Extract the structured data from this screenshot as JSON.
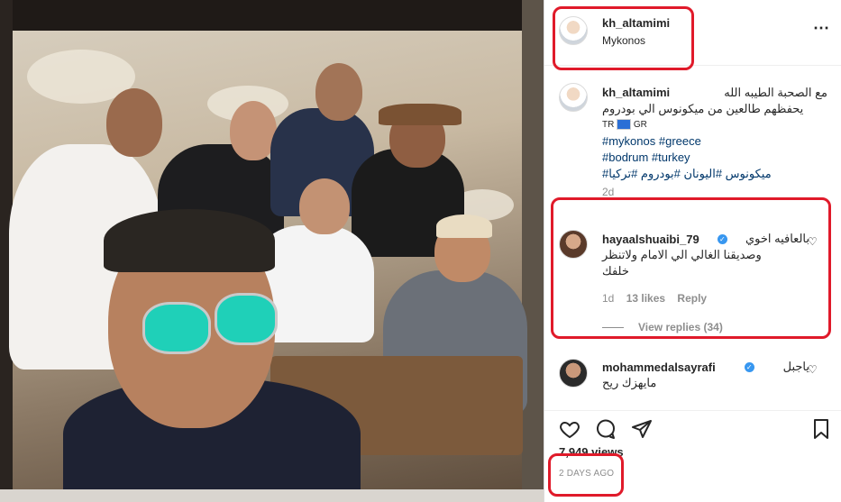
{
  "post": {
    "author": "kh_altamimi",
    "location": "Mykonos",
    "more_icon": "more-icon",
    "caption_line1": "مع الصحبة الطيبه الله",
    "caption_line2": "يحفظهم طالعين من ميكونوس الي بودروم",
    "caption_flags_left": "TR",
    "caption_flags_right": "GR",
    "hashtags_line1": "#mykonos #greece",
    "hashtags_line2": "#bodrum #turkey",
    "hashtags_line3": "ميكونوس #اليونان #بودروم #تركيا#",
    "caption_age": "2d",
    "views": "7,949 views",
    "date": "2 DAYS AGO"
  },
  "comments": [
    {
      "username": "hayaalshuaibi_79",
      "verified": true,
      "text_line1": "بالعافيه اخوي",
      "text_line2": "وصديقنا الغالي الي الامام ولاتنظر",
      "text_line3": "خلفك",
      "age": "1d",
      "likes": "13 likes",
      "reply": "Reply",
      "view_replies": "View replies (34)"
    },
    {
      "username": "mohammedalsayrafi",
      "verified": true,
      "text_line1": "ياجبل",
      "text_line2": "مايهزك ريح"
    }
  ],
  "colors": {
    "highlight_red": "#e01a2a",
    "hashtag_blue": "#00376b",
    "verified_blue": "#3897f0",
    "muted_gray": "#8e8e8e"
  }
}
